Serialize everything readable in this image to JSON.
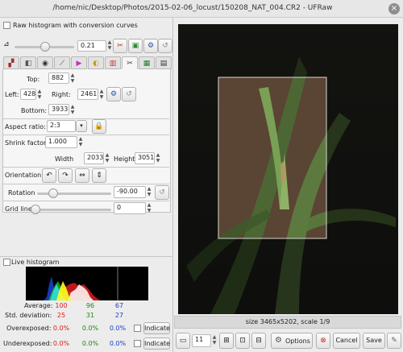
{
  "window": {
    "title": "/home/nic/Desktop/Photos/2015-02-06_locust/150208_NAT_004.CR2 - UFRaw"
  },
  "histogram_options": {
    "raw_histogram_label": "Raw histogram with conversion curves",
    "exposure_value": "0.21"
  },
  "tabs": [
    {
      "icon": "raw-icon"
    },
    {
      "icon": "whitebalance-icon"
    },
    {
      "icon": "color-wheel-icon"
    },
    {
      "icon": "curve-icon"
    },
    {
      "icon": "color-management-icon"
    },
    {
      "icon": "lightness-icon"
    },
    {
      "icon": "color-bars-icon"
    },
    {
      "icon": "crop-rotate-icon"
    },
    {
      "icon": "save-icon"
    },
    {
      "icon": "exif-icon"
    }
  ],
  "crop": {
    "top_label": "Top:",
    "top_value": "882",
    "left_label": "Left:",
    "left_value": "428",
    "right_label": "Right:",
    "right_value": "2461",
    "bottom_label": "Bottom:",
    "bottom_value": "3933",
    "aspect_label": "Aspect ratio:",
    "aspect_value": "2:3",
    "shrink_label": "Shrink factor",
    "shrink_value": "1.000",
    "width_label": "Width",
    "width_value": "2033",
    "height_label": "Height",
    "height_value": "3051",
    "orientation_label": "Orientation:"
  },
  "rotation": {
    "label": "Rotation",
    "value": "-90.00"
  },
  "gridlines": {
    "label": "Grid lines",
    "value": "0"
  },
  "live_histogram": {
    "label": "Live histogram",
    "average_label": "Average:",
    "average": [
      "100",
      "96",
      "67"
    ],
    "std_label": "Std. deviation:",
    "std": [
      "25",
      "31",
      "27"
    ],
    "over_label": "Overexposed:",
    "over": [
      "0.0%",
      "0.0%",
      "0.0%"
    ],
    "under_label": "Underexposed:",
    "under": [
      "0.0%",
      "0.0%",
      "0.0%"
    ],
    "indicate_label": "Indicate",
    "channel_colors": [
      "#e01c1c",
      "#1a8a1a",
      "#1a3fc8"
    ]
  },
  "preview": {
    "status": "size 3465x5202, scale 1/9"
  },
  "bottom_bar": {
    "zoom_value": "11",
    "options_label": "Options",
    "cancel_label": "Cancel",
    "save_label": "Save"
  }
}
